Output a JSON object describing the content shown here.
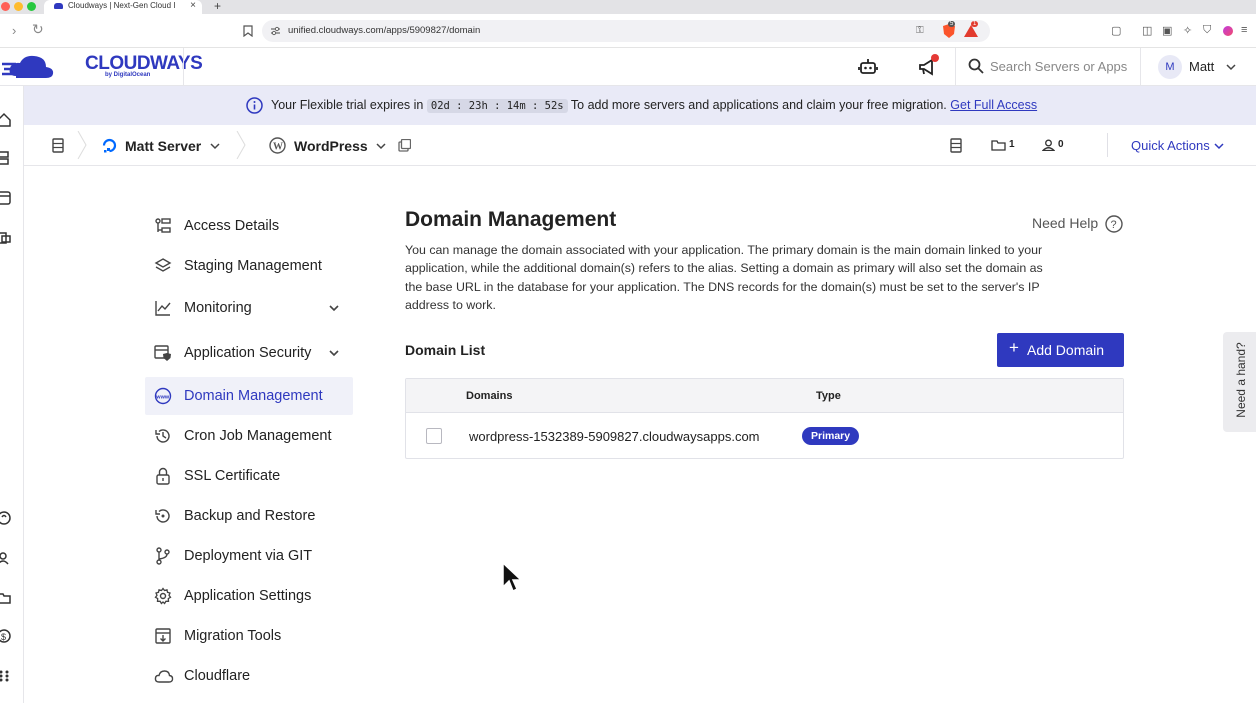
{
  "browser": {
    "tab_title": "Cloudways | Next-Gen Cloud I",
    "url": "unified.cloudways.com/apps/5909827/domain",
    "extension_badge_1": "5",
    "extension_badge_2": "1"
  },
  "header": {
    "logo": "CLOUDWAYS",
    "logo_sub": "by DigitalOcean",
    "search_placeholder": "Search Servers or Apps",
    "avatar_initial": "M",
    "username": "Matt"
  },
  "banner": {
    "prefix": "Your Flexible trial expires in",
    "timer": "02d : 23h : 14m : 52s",
    "suffix": "To add more servers and applications and claim your free migration.",
    "link": "Get Full Access"
  },
  "breadcrumb": {
    "server": "Matt Server",
    "app": "WordPress",
    "folder_count": "1",
    "user_count": "0",
    "quick_actions": "Quick Actions"
  },
  "sidebar": {
    "items": [
      {
        "label": "Access Details"
      },
      {
        "label": "Staging Management"
      },
      {
        "label": "Monitoring"
      },
      {
        "label": "Application Security"
      },
      {
        "label": "Domain Management"
      },
      {
        "label": "Cron Job Management"
      },
      {
        "label": "SSL Certificate"
      },
      {
        "label": "Backup and Restore"
      },
      {
        "label": "Deployment via GIT"
      },
      {
        "label": "Application Settings"
      },
      {
        "label": "Migration Tools"
      },
      {
        "label": "Cloudflare"
      }
    ]
  },
  "main": {
    "title": "Domain Management",
    "need_help": "Need Help",
    "description": "You can manage the domain associated with your application. The primary domain is the main domain linked to your application, while the additional domain(s) refers to the alias. Setting a domain as primary will also set the domain as the base URL in the database for your application. The DNS records for the domain(s) must be set to the server's IP address to work.",
    "domain_list_title": "Domain List",
    "add_domain": "Add Domain",
    "table": {
      "headers": [
        "Domains",
        "Type"
      ],
      "rows": [
        {
          "domain": "wordpress-1532389-5909827.cloudwaysapps.com",
          "type": "Primary"
        }
      ]
    }
  },
  "need_a_hand": "Need a hand?",
  "colors": {
    "accent": "#2f39bf",
    "banner_bg": "#e9eaf7"
  }
}
